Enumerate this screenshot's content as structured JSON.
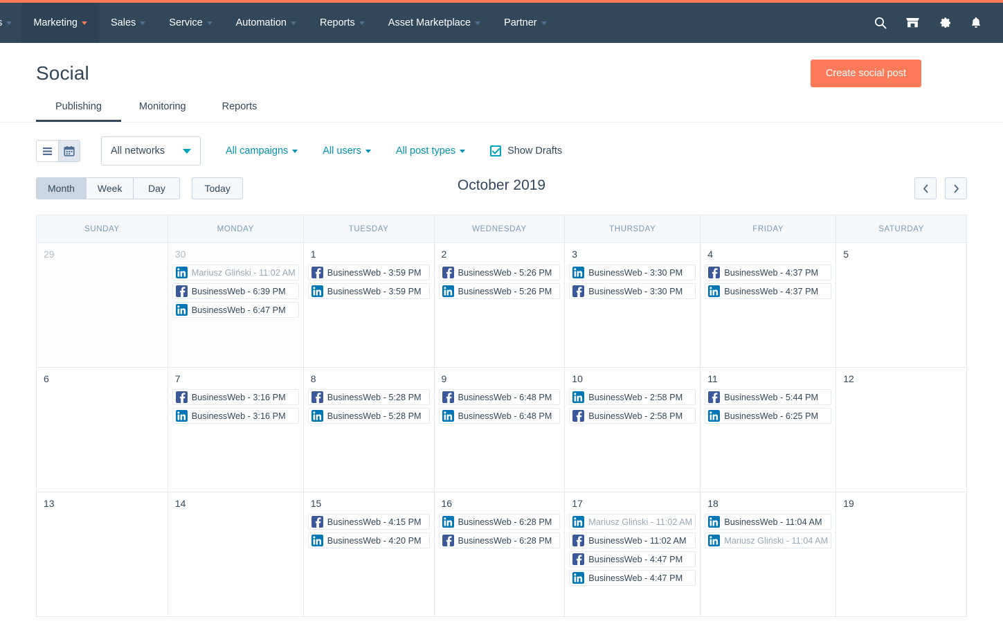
{
  "brand": {
    "accent_orange": "#FF7A59",
    "nav_bg": "#33475B",
    "teal": "#00A4BD",
    "linkedin_blue": "#0077B5",
    "facebook_blue": "#3B5998"
  },
  "topnav": {
    "items": [
      {
        "label": "ns",
        "truncated": true,
        "active": false
      },
      {
        "label": "Marketing",
        "truncated": false,
        "active": true
      },
      {
        "label": "Sales",
        "truncated": false,
        "active": false
      },
      {
        "label": "Service",
        "truncated": false,
        "active": false
      },
      {
        "label": "Automation",
        "truncated": false,
        "active": false
      },
      {
        "label": "Reports",
        "truncated": false,
        "active": false
      },
      {
        "label": "Asset Marketplace",
        "truncated": false,
        "active": false
      },
      {
        "label": "Partner",
        "truncated": false,
        "active": false
      }
    ],
    "icons": [
      "search-icon",
      "marketplace-icon",
      "settings-gear-icon",
      "notifications-bell-icon"
    ]
  },
  "header": {
    "title": "Social",
    "create_button": "Create social post",
    "tabs": [
      {
        "label": "Publishing",
        "active": true
      },
      {
        "label": "Monitoring",
        "active": false
      },
      {
        "label": "Reports",
        "active": false
      }
    ]
  },
  "toolbar": {
    "view_list_icon": "list-view-icon",
    "view_calendar_icon": "calendar-view-icon",
    "active_view": "calendar",
    "network_select": "All networks",
    "filters": [
      {
        "label": "All campaigns"
      },
      {
        "label": "All users"
      },
      {
        "label": "All post types"
      }
    ],
    "show_drafts_label": "Show Drafts",
    "show_drafts_checked": true
  },
  "calendar_controls": {
    "ranges": [
      {
        "label": "Month",
        "active": true
      },
      {
        "label": "Week",
        "active": false
      },
      {
        "label": "Day",
        "active": false
      }
    ],
    "today_label": "Today",
    "month_label": "October 2019",
    "prev_icon": "chevron-left-icon",
    "next_icon": "chevron-right-icon"
  },
  "calendar": {
    "day_headers": [
      "SUNDAY",
      "MONDAY",
      "TUESDAY",
      "WEDNESDAY",
      "THURSDAY",
      "FRIDAY",
      "SATURDAY"
    ],
    "weeks": [
      [
        {
          "day": "29",
          "other_month": true,
          "events": []
        },
        {
          "day": "30",
          "other_month": true,
          "events": [
            {
              "network": "linkedin",
              "account": "Mariusz Gliński",
              "time": "11:02 AM",
              "draft": true
            },
            {
              "network": "facebook",
              "account": "BusinessWeb",
              "time": "6:39 PM",
              "draft": false
            },
            {
              "network": "linkedin",
              "account": "BusinessWeb",
              "time": "6:47 PM",
              "draft": false
            }
          ]
        },
        {
          "day": "1",
          "other_month": false,
          "events": [
            {
              "network": "facebook",
              "account": "BusinessWeb",
              "time": "3:59 PM",
              "draft": false
            },
            {
              "network": "linkedin",
              "account": "BusinessWeb",
              "time": "3:59 PM",
              "draft": false
            }
          ]
        },
        {
          "day": "2",
          "other_month": false,
          "events": [
            {
              "network": "facebook",
              "account": "BusinessWeb",
              "time": "5:26 PM",
              "draft": false
            },
            {
              "network": "linkedin",
              "account": "BusinessWeb",
              "time": "5:26 PM",
              "draft": false
            }
          ]
        },
        {
          "day": "3",
          "other_month": false,
          "events": [
            {
              "network": "linkedin",
              "account": "BusinessWeb",
              "time": "3:30 PM",
              "draft": false
            },
            {
              "network": "facebook",
              "account": "BusinessWeb",
              "time": "3:30 PM",
              "draft": false
            }
          ]
        },
        {
          "day": "4",
          "other_month": false,
          "events": [
            {
              "network": "facebook",
              "account": "BusinessWeb",
              "time": "4:37 PM",
              "draft": false
            },
            {
              "network": "linkedin",
              "account": "BusinessWeb",
              "time": "4:37 PM",
              "draft": false
            }
          ]
        },
        {
          "day": "5",
          "other_month": false,
          "events": []
        }
      ],
      [
        {
          "day": "6",
          "other_month": false,
          "events": []
        },
        {
          "day": "7",
          "other_month": false,
          "events": [
            {
              "network": "facebook",
              "account": "BusinessWeb",
              "time": "3:16 PM",
              "draft": false
            },
            {
              "network": "linkedin",
              "account": "BusinessWeb",
              "time": "3:16 PM",
              "draft": false
            }
          ]
        },
        {
          "day": "8",
          "other_month": false,
          "events": [
            {
              "network": "facebook",
              "account": "BusinessWeb",
              "time": "5:28 PM",
              "draft": false
            },
            {
              "network": "linkedin",
              "account": "BusinessWeb",
              "time": "5:28 PM",
              "draft": false
            }
          ]
        },
        {
          "day": "9",
          "other_month": false,
          "events": [
            {
              "network": "facebook",
              "account": "BusinessWeb",
              "time": "6:48 PM",
              "draft": false
            },
            {
              "network": "linkedin",
              "account": "BusinessWeb",
              "time": "6:48 PM",
              "draft": false
            }
          ]
        },
        {
          "day": "10",
          "other_month": false,
          "events": [
            {
              "network": "linkedin",
              "account": "BusinessWeb",
              "time": "2:58 PM",
              "draft": false
            },
            {
              "network": "facebook",
              "account": "BusinessWeb",
              "time": "2:58 PM",
              "draft": false
            }
          ]
        },
        {
          "day": "11",
          "other_month": false,
          "events": [
            {
              "network": "facebook",
              "account": "BusinessWeb",
              "time": "5:44 PM",
              "draft": false
            },
            {
              "network": "linkedin",
              "account": "BusinessWeb",
              "time": "6:25 PM",
              "draft": false
            }
          ]
        },
        {
          "day": "12",
          "other_month": false,
          "events": []
        }
      ],
      [
        {
          "day": "13",
          "other_month": false,
          "events": []
        },
        {
          "day": "14",
          "other_month": false,
          "events": []
        },
        {
          "day": "15",
          "other_month": false,
          "events": [
            {
              "network": "facebook",
              "account": "BusinessWeb",
              "time": "4:15 PM",
              "draft": false
            },
            {
              "network": "linkedin",
              "account": "BusinessWeb",
              "time": "4:20 PM",
              "draft": false
            }
          ]
        },
        {
          "day": "16",
          "other_month": false,
          "events": [
            {
              "network": "linkedin",
              "account": "BusinessWeb",
              "time": "6:28 PM",
              "draft": false
            },
            {
              "network": "facebook",
              "account": "BusinessWeb",
              "time": "6:28 PM",
              "draft": false
            }
          ]
        },
        {
          "day": "17",
          "other_month": false,
          "events": [
            {
              "network": "linkedin",
              "account": "Mariusz Gliński",
              "time": "11:02 AM",
              "draft": true
            },
            {
              "network": "facebook",
              "account": "BusinessWeb",
              "time": "11:02 AM",
              "draft": false
            },
            {
              "network": "facebook",
              "account": "BusinessWeb",
              "time": "4:47 PM",
              "draft": false
            },
            {
              "network": "linkedin",
              "account": "BusinessWeb",
              "time": "4:47 PM",
              "draft": false
            }
          ]
        },
        {
          "day": "18",
          "other_month": false,
          "events": [
            {
              "network": "linkedin",
              "account": "BusinessWeb",
              "time": "11:04 AM",
              "draft": false
            },
            {
              "network": "linkedin",
              "account": "Mariusz Gliński",
              "time": "11:04 AM",
              "draft": true
            }
          ]
        },
        {
          "day": "19",
          "other_month": false,
          "events": []
        }
      ]
    ]
  }
}
